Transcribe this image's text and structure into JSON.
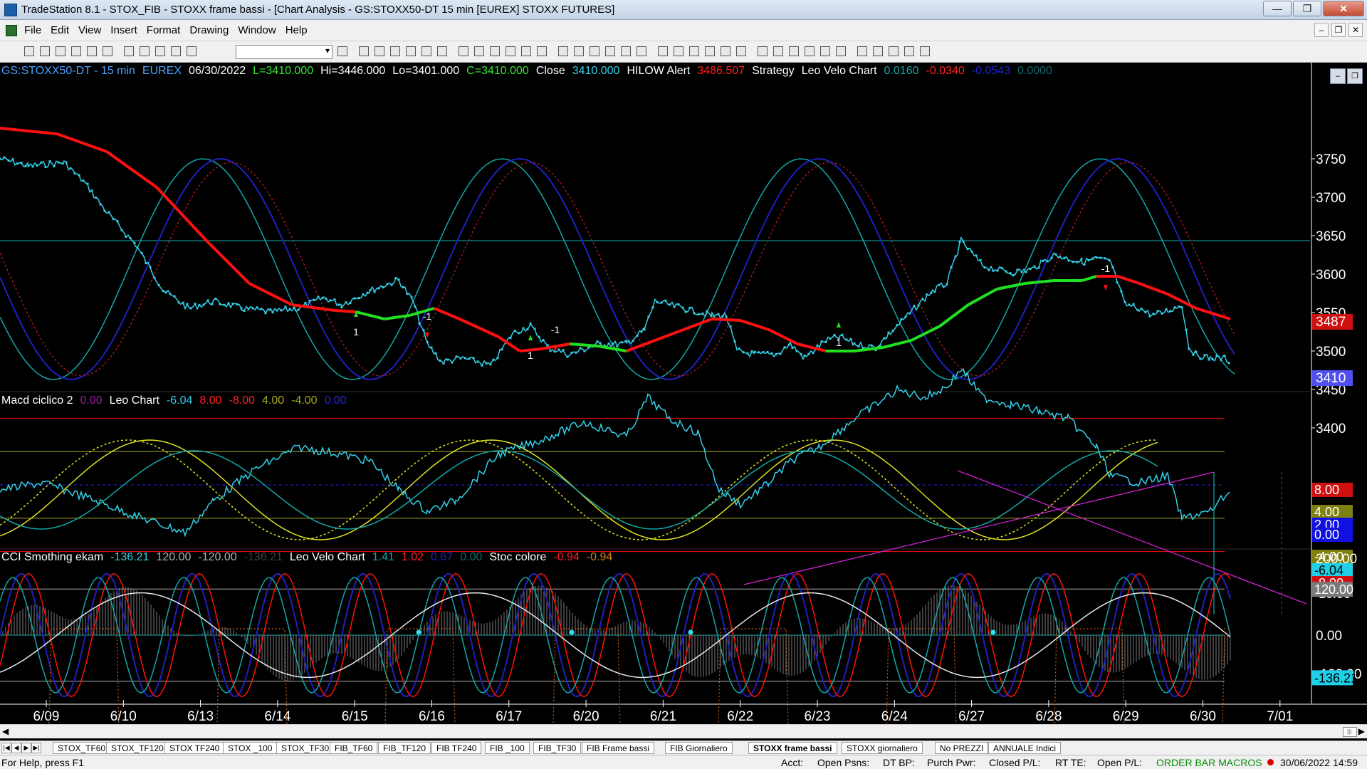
{
  "window": {
    "title": "TradeStation 8.1 - STOX_FIB - STOXX frame bassi - [Chart Analysis - GS:STOXX50-DT  15 min  [EUREX] STOXX FUTURES]",
    "minimize_glyph": "—",
    "restore_glyph": "❐",
    "close_glyph": "✕"
  },
  "menu": [
    "File",
    "Edit",
    "View",
    "Insert",
    "Format",
    "Drawing",
    "Window",
    "Help"
  ],
  "mdi": {
    "minimize_glyph": "–",
    "restore_glyph": "❐",
    "close_glyph": "✕"
  },
  "panel_controls": {
    "minimize_glyph": "–",
    "restore_glyph": "❐"
  },
  "scroll_glyphs": {
    "left": "◀",
    "right": "▶",
    "thumb": "|||"
  },
  "toolbar": {
    "combo_value": "",
    "icons": [
      "new-doc-icon",
      "open-icon",
      "save-icon",
      "save-all-icon",
      "print-icon",
      "print-preview-icon",
      "desktop-icon",
      "workspace-icon",
      "lock-icon",
      "insert-icon",
      "globe-icon",
      "dropdown-icon",
      "arrow-icon",
      "find-icon",
      "chart-icon",
      "analysis-icon",
      "grid-icon",
      "refresh-icon",
      "quote-icon",
      "news-icon",
      "scanner-icon",
      "matrix-icon",
      "radar-icon",
      "scope-icon",
      "bars-icon",
      "candles-icon",
      "box-icon",
      "line-icon",
      "zoom-in-icon",
      "zoom-out-icon",
      "pointer-icon",
      "cursor-icon",
      "tool-icon",
      "ruler-icon",
      "eraser-icon",
      "trendline-icon",
      "fib-icon",
      "channel-icon",
      "pitchfork-icon",
      "arc-icon",
      "horizontal-icon",
      "vertical-icon",
      "arrows-icon",
      "speed-icon",
      "ellipse-icon",
      "rectangle-icon",
      "text-icon"
    ]
  },
  "chart": {
    "price_legend": [
      {
        "text": "GS:STOXX50-DT - 15 min",
        "color": "#4aa3ff"
      },
      {
        "text": "EUREX",
        "color": "#4aa3ff"
      },
      {
        "text": "06/30/2022",
        "color": "#ffffff"
      },
      {
        "text": "L=3410.000",
        "color": "#33e833"
      },
      {
        "text": "Hi=3446.000",
        "color": "#ffffff"
      },
      {
        "text": "Lo=3401.000",
        "color": "#ffffff"
      },
      {
        "text": "C=3410.000",
        "color": "#33e833"
      },
      {
        "text": "Close",
        "color": "#ffffff"
      },
      {
        "text": "3410.000",
        "color": "#33d0e8"
      },
      {
        "text": "HILOW Alert",
        "color": "#ffffff"
      },
      {
        "text": "3486.507",
        "color": "#ff2020"
      },
      {
        "text": "Strategy",
        "color": "#ffffff"
      },
      {
        "text": "Leo Velo Chart",
        "color": "#ffffff"
      },
      {
        "text": "0.0160",
        "color": "#13a8a8"
      },
      {
        "text": "-0.0340",
        "color": "#ff2020"
      },
      {
        "text": "-0.0543",
        "color": "#2323c8"
      },
      {
        "text": "0.0000",
        "color": "#0d6b6b"
      }
    ],
    "macd_legend": [
      {
        "text": "Macd ciclico 2",
        "color": "#ffffff"
      },
      {
        "text": "0.00",
        "color": "#9b1a9b"
      },
      {
        "text": "Leo Chart",
        "color": "#ffffff"
      },
      {
        "text": "-6.04",
        "color": "#33d0e8"
      },
      {
        "text": "8.00",
        "color": "#ff2020"
      },
      {
        "text": "-8.00",
        "color": "#ff2020"
      },
      {
        "text": "4.00",
        "color": "#a8a820"
      },
      {
        "text": "-4.00",
        "color": "#a8a820"
      },
      {
        "text": "0.00",
        "color": "#2323e8"
      }
    ],
    "cci_legend": [
      {
        "text": "CCI Smothing ekam",
        "color": "#ffffff"
      },
      {
        "text": "-136.21",
        "color": "#33d0e8"
      },
      {
        "text": "120.00",
        "color": "#b0b0b0"
      },
      {
        "text": "-120.00",
        "color": "#b0b0b0"
      },
      {
        "text": "-136.21",
        "color": "#404040"
      },
      {
        "text": "Leo Velo Chart",
        "color": "#ffffff"
      },
      {
        "text": "1.41",
        "color": "#13a8a8"
      },
      {
        "text": "1.02",
        "color": "#ff2020"
      },
      {
        "text": "0.67",
        "color": "#2323c8"
      },
      {
        "text": "0.00",
        "color": "#0d6b6b"
      },
      {
        "text": "Stoc colore",
        "color": "#ffffff"
      },
      {
        "text": "-0.94",
        "color": "#ff2020"
      },
      {
        "text": "-0.94",
        "color": "#d08020"
      }
    ],
    "price_ticks": [
      "3750",
      "3700",
      "3650",
      "3600",
      "3550",
      "3500",
      "3450",
      "3400"
    ],
    "price_badges": [
      {
        "text": "3487",
        "bg": "#d01010",
        "fg": "#ffffff"
      },
      {
        "text": "3410",
        "bg": "#5050f0",
        "fg": "#ffffff"
      }
    ],
    "macd_badges": [
      {
        "text": "8.00",
        "bg": "#d01010",
        "fg": "#ffffff"
      },
      {
        "text": "4.00",
        "bg": "#808010",
        "fg": "#ffffff"
      },
      {
        "text": "2.00",
        "bg": "#1010e0",
        "fg": "#ffffff"
      },
      {
        "text": "0.00",
        "bg": "#1010e0",
        "fg": "#ffffff"
      },
      {
        "text": "-4.00",
        "bg": "#808010",
        "fg": "#ffffff"
      },
      {
        "text": "-6.04",
        "bg": "#20d0e8",
        "fg": "#000000"
      },
      {
        "text": "-8.00",
        "bg": "#d01010",
        "fg": "#ffffff"
      },
      {
        "text": "-10.00",
        "bg": "#000000",
        "fg": "#ffffff"
      }
    ],
    "cci_ticks": [
      "200.00",
      "0.00",
      "-100.00"
    ],
    "cci_badges": [
      {
        "text": "120.00",
        "bg": "#7a7a7a",
        "fg": "#ffffff"
      },
      {
        "text": "-136.21",
        "bg": "#20d0e8",
        "fg": "#000000"
      }
    ],
    "dates": [
      "6/09",
      "6/10",
      "6/13",
      "6/14",
      "6/15",
      "6/16",
      "6/17",
      "6/20",
      "6/21",
      "6/22",
      "6/23",
      "6/24",
      "6/27",
      "6/28",
      "6/29",
      "6/30",
      "7/01"
    ],
    "signal_labels": [
      "1",
      "-1",
      "1",
      "-1",
      "1",
      "-1"
    ],
    "colors": {
      "price": "#33d0e8",
      "ma_red": "#ff1010",
      "ma_green": "#20e020",
      "cycle_teal": "#13a8a8",
      "cycle_blue": "#2020c0",
      "cycle_red_dot": "#c02020",
      "macd_yellow": "#e0e020",
      "trend_magenta": "#d020d0",
      "cci_white": "#e8e8e8",
      "stoc_orange": "#d06010"
    }
  },
  "tabs": [
    "STOX_TF60",
    "STOX_TF120",
    "STOX TF240",
    "STOX _100",
    "STOX_TF30",
    "FIB_TF60",
    "FIB_TF120",
    "FIB TF240",
    "FIB _100",
    "FIB_TF30",
    "FIB Frame bassi",
    "FIB Giornaliero",
    "STOXX frame bassi",
    "STOXX giornaliero",
    "No PREZZI",
    "ANNUALE Indici"
  ],
  "active_tab": "STOXX frame bassi",
  "tab_nav": [
    "|◀",
    "◀",
    "▶",
    "▶|"
  ],
  "status": {
    "help": "For Help, press F1",
    "acct": "Acct:",
    "open_psns": "Open Psns:",
    "dt_bp": "DT BP:",
    "purch_pwr": "Purch Pwr:",
    "closed_pl": "Closed P/L:",
    "rt_te": "RT TE:",
    "open_pl": "Open P/L:",
    "macros": "ORDER BAR  MACROS",
    "datetime": "30/06/2022 14:59"
  }
}
